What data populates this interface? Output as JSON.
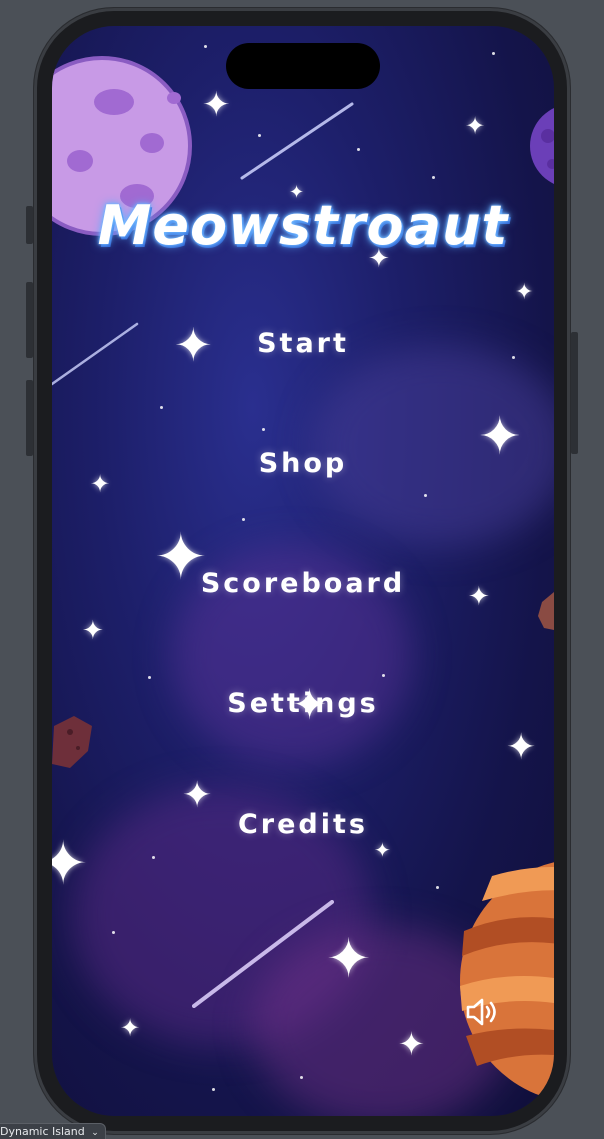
{
  "game": {
    "title": "Meowstroaut",
    "menu": [
      {
        "label": "Start"
      },
      {
        "label": "Shop"
      },
      {
        "label": "Scoreboard"
      },
      {
        "label": "Settings"
      },
      {
        "label": "Credits"
      }
    ],
    "sound_icon": "speaker-volume-icon"
  },
  "device": {
    "label": "Dynamic Island"
  },
  "colors": {
    "background": "#14144a",
    "title_glow": "#5aa8ff",
    "text": "#ffffff"
  }
}
